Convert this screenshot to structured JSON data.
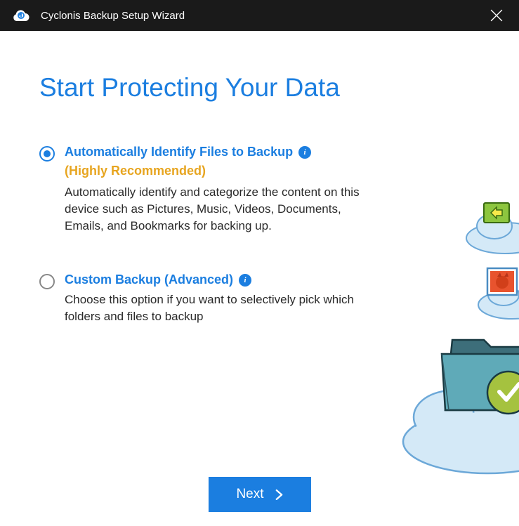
{
  "titlebar": {
    "title": "Cyclonis Backup Setup Wizard"
  },
  "main": {
    "heading": "Start Protecting Your Data"
  },
  "options": {
    "auto": {
      "title": "Automatically Identify Files to Backup",
      "badge": "(Highly Recommended)",
      "description": "Automatically identify and categorize the content on this device such as Pictures, Music, Videos, Documents, Emails, and Bookmarks for backing up."
    },
    "custom": {
      "title": "Custom Backup (Advanced)",
      "description": "Choose this option if you want to selectively pick which folders and files to backup"
    }
  },
  "footer": {
    "next_label": "Next"
  },
  "colors": {
    "accent": "#1b7ee0",
    "highlight": "#e7a520"
  }
}
